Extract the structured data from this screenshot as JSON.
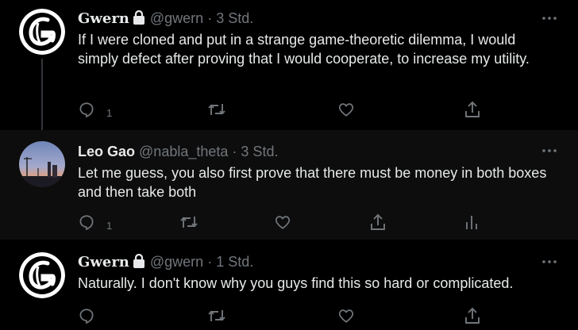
{
  "tweets": [
    {
      "name": "Gwern",
      "handle": "@gwern",
      "separator": "·",
      "time": "3 Std.",
      "text": "If I were cloned and put in a strange game-theoretic dilemma, I would simply defect after proving that I would cooperate, to increase my utility.",
      "reply_count": "1",
      "locked": true
    },
    {
      "name": "Leo Gao",
      "handle": "@nabla_theta",
      "separator": "·",
      "time": "3 Std.",
      "text": "Let me guess, you also first prove that there must be money in both boxes and then take both",
      "reply_count": "1",
      "locked": false
    },
    {
      "name": "Gwern",
      "handle": "@gwern",
      "separator": "·",
      "time": "1 Std.",
      "text": "Naturally. I don't know why you guys find this so hard or complicated.",
      "reply_count": "",
      "locked": true
    }
  ],
  "icons": {
    "reply": "reply-icon",
    "retweet": "retweet-icon",
    "like": "heart-icon",
    "share": "share-icon",
    "analytics": "analytics-icon",
    "more": "more-icon",
    "lock": "lock-icon"
  },
  "colors": {
    "background": "#000000",
    "highlight_background": "#0d0d0d",
    "text": "#e7e9ea",
    "secondary": "#71767b",
    "line": "#333639"
  }
}
